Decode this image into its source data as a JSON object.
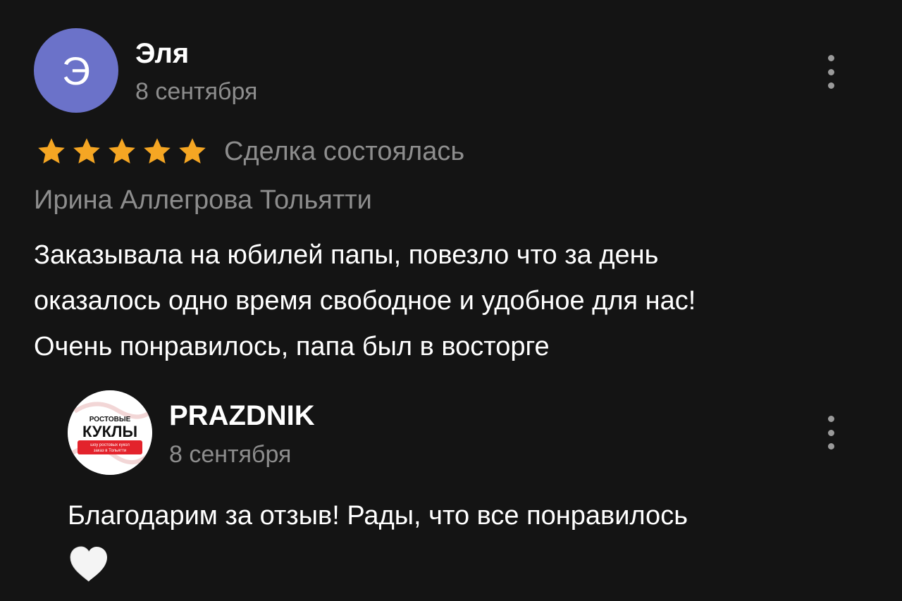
{
  "review": {
    "author_initial": "Э",
    "author_name": "Эля",
    "date": "8 сентября",
    "rating": 5,
    "star_color": "#f5a623",
    "deal_status": "Сделка состоялась",
    "listing_title": "Ирина Аллегрова Тольятти",
    "text_lines": [
      "Заказывала на юбилей папы, повезло что за день",
      "оказалось одно время свободное и удобное для нас!",
      "Очень понравилось, папа был в восторге"
    ]
  },
  "reply": {
    "author_name": "PRAZDNIK",
    "date": "8 сентября",
    "logo": {
      "line1": "РОСТОВЫЕ",
      "line2": "КУКЛЫ",
      "line3": "шоу ростовых кукол",
      "line4": "заказ в Тольятти"
    },
    "text": "Благодарим за отзыв! Рады, что все понравилось",
    "emoji": "white-heart-icon"
  },
  "colors": {
    "background": "#141414",
    "avatar_user": "#6b72c9",
    "muted_text": "#8d8d8d",
    "logo_red": "#e3232c"
  }
}
